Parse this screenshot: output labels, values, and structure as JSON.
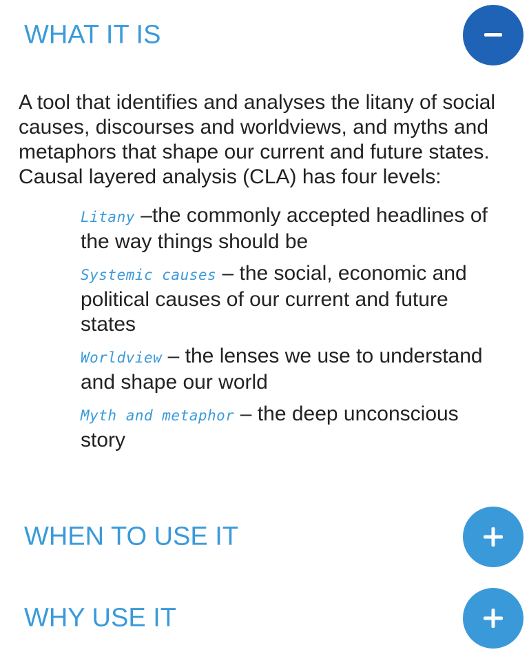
{
  "sections": [
    {
      "title": "WHAT IT IS",
      "state": "expanded",
      "toggle_icon": "minus-icon",
      "color": "#1e63b5"
    },
    {
      "title": "WHEN TO USE IT",
      "state": "collapsed",
      "toggle_icon": "plus-icon",
      "color": "#3a9ad9"
    },
    {
      "title": "WHY USE IT",
      "state": "collapsed",
      "toggle_icon": "plus-icon",
      "color": "#3a9ad9"
    }
  ],
  "what_it_is": {
    "intro": "A tool that identifies and analyses the litany of social causes, discourses and worldviews, and myths and metaphors that shape our current and future states. Causal layered analysis (CLA) has four levels:",
    "levels": [
      {
        "term": "Litany",
        "desc": "–the commonly accepted headlines of the way things should be"
      },
      {
        "term": "Systemic causes",
        "desc": "– the social, economic and political causes of our current and future states"
      },
      {
        "term": "Worldview",
        "desc": "– the lenses we use to understand and shape our world"
      },
      {
        "term": "Myth and metaphor",
        "desc": "– the deep unconscious story"
      }
    ]
  },
  "colors": {
    "title": "#3a9ad9",
    "toggle_active": "#1e63b5",
    "toggle_inactive": "#3a9ad9",
    "body_text": "#222222",
    "term_text": "#3a9ad9"
  }
}
